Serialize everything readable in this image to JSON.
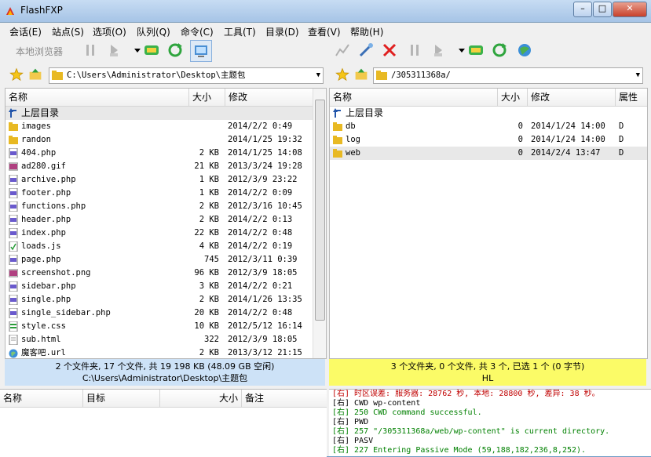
{
  "window": {
    "title": "FlashFXP",
    "minimize": "–",
    "maximize": "□",
    "close": "✕"
  },
  "menu": [
    "会话(E)",
    "站点(S)",
    "选项(O)",
    "队列(Q)",
    "命令(C)",
    "工具(T)",
    "目录(D)",
    "查看(V)",
    "帮助(H)"
  ],
  "toolbar": {
    "local_browser_label": "本地浏览器"
  },
  "left": {
    "path": "C:\\Users\\Administrator\\Desktop\\主题包",
    "columns": {
      "name": "名称",
      "size": "大小",
      "modified": "修改"
    },
    "up_label": "上层目录",
    "files": [
      {
        "name": "images",
        "size": "",
        "date": "2014/2/2 0:49",
        "icon": "folder-icon"
      },
      {
        "name": "randon",
        "size": "",
        "date": "2014/1/25 19:32",
        "icon": "folder-icon"
      },
      {
        "name": "404.php",
        "size": "2 KB",
        "date": "2014/1/25 14:08",
        "icon": "php-file-icon"
      },
      {
        "name": "ad280.gif",
        "size": "21 KB",
        "date": "2013/3/24 19:28",
        "icon": "image-file-icon"
      },
      {
        "name": "archive.php",
        "size": "1 KB",
        "date": "2012/3/9 23:22",
        "icon": "php-file-icon"
      },
      {
        "name": "footer.php",
        "size": "1 KB",
        "date": "2014/2/2 0:09",
        "icon": "php-file-icon"
      },
      {
        "name": "functions.php",
        "size": "2 KB",
        "date": "2012/3/16 10:45",
        "icon": "php-file-icon"
      },
      {
        "name": "header.php",
        "size": "2 KB",
        "date": "2014/2/2 0:13",
        "icon": "php-file-icon"
      },
      {
        "name": "index.php",
        "size": "22 KB",
        "date": "2014/2/2 0:48",
        "icon": "php-file-icon"
      },
      {
        "name": "loads.js",
        "size": "4 KB",
        "date": "2014/2/2 0:19",
        "icon": "js-file-icon"
      },
      {
        "name": "page.php",
        "size": "745",
        "date": "2012/3/11 0:39",
        "icon": "php-file-icon"
      },
      {
        "name": "screenshot.png",
        "size": "96 KB",
        "date": "2012/3/9 18:05",
        "icon": "image-file-icon"
      },
      {
        "name": "sidebar.php",
        "size": "3 KB",
        "date": "2014/2/2 0:21",
        "icon": "php-file-icon"
      },
      {
        "name": "single.php",
        "size": "2 KB",
        "date": "2014/1/26 13:35",
        "icon": "php-file-icon"
      },
      {
        "name": "single_sidebar.php",
        "size": "20 KB",
        "date": "2014/2/2 0:48",
        "icon": "php-file-icon"
      },
      {
        "name": "style.css",
        "size": "10 KB",
        "date": "2012/5/12 16:14",
        "icon": "css-file-icon"
      },
      {
        "name": "sub.html",
        "size": "322",
        "date": "2012/3/9 18:05",
        "icon": "html-file-icon"
      },
      {
        "name": "魔客吧.url",
        "size": "2 KB",
        "date": "2013/3/12 21:15",
        "icon": "url-file-icon"
      }
    ],
    "status_line1": "2 个文件夹, 17 个文件, 共 19 198 KB (48.09 GB 空闲)",
    "status_line2": "C:\\Users\\Administrator\\Desktop\\主题包"
  },
  "right": {
    "path": "/305311368a/",
    "columns": {
      "name": "名称",
      "size": "大小",
      "modified": "修改",
      "attr": "属性"
    },
    "up_label": "上层目录",
    "files": [
      {
        "name": "db",
        "size": "0",
        "date": "2014/1/24 14:00",
        "attr": "D",
        "icon": "folder-icon"
      },
      {
        "name": "log",
        "size": "0",
        "date": "2014/1/24 14:00",
        "attr": "D",
        "icon": "folder-icon"
      },
      {
        "name": "web",
        "size": "0",
        "date": "2014/2/4 13:47",
        "attr": "D",
        "icon": "folder-icon"
      }
    ],
    "status_line1": "3 个文件夹, 0 个文件, 共 3 个, 已选 1 个 (0 字节)",
    "status_line2": "HL"
  },
  "queue": {
    "columns": {
      "name": "名称",
      "target": "目标",
      "size": "大小",
      "note": "备注"
    }
  },
  "log": [
    {
      "text": "[右] 时区误差: 服务器: 28762 秒, 本地: 28800 秒, 差异: 38 秒。",
      "cls": "r"
    },
    {
      "text": "[右] CWD wp-content",
      "cls": "b"
    },
    {
      "text": "[右] 250 CWD command successful.",
      "cls": "g"
    },
    {
      "text": "[右] PWD",
      "cls": "b"
    },
    {
      "text": "[右] 257 \"/305311368a/web/wp-content\" is current directory.",
      "cls": "g"
    },
    {
      "text": "[右] PASV",
      "cls": "b"
    },
    {
      "text": "[右] 227 Entering Passive Mode (59,188,182,236,8,252).",
      "cls": "g"
    }
  ],
  "colors": {
    "left_status_bg": "#cde2f7",
    "right_status_bg": "#fbfb67",
    "log_green": "#008000"
  }
}
